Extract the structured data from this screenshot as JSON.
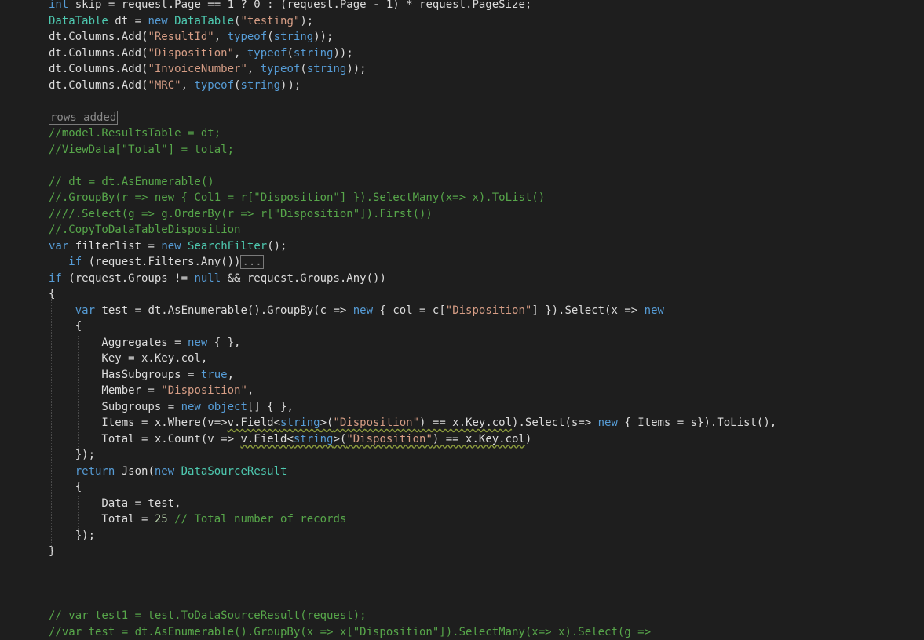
{
  "editor": {
    "lines": [
      {
        "tokens": [
          {
            "t": "kw",
            "v": "int"
          },
          {
            "t": "pl",
            "v": " skip = request.Page == 1 ? 0 : (request.Page - 1) * request.PageSize;"
          }
        ]
      },
      {
        "tokens": [
          {
            "t": "ty",
            "v": "DataTable"
          },
          {
            "t": "pl",
            "v": " dt = "
          },
          {
            "t": "kw",
            "v": "new"
          },
          {
            "t": "pl",
            "v": " "
          },
          {
            "t": "ty",
            "v": "DataTable"
          },
          {
            "t": "pl",
            "v": "("
          },
          {
            "t": "str",
            "v": "\"testing\""
          },
          {
            "t": "pl",
            "v": ");"
          }
        ]
      },
      {
        "tokens": [
          {
            "t": "pl",
            "v": "dt.Columns.Add("
          },
          {
            "t": "str",
            "v": "\"ResultId\""
          },
          {
            "t": "pl",
            "v": ", "
          },
          {
            "t": "kw",
            "v": "typeof"
          },
          {
            "t": "pl",
            "v": "("
          },
          {
            "t": "kw",
            "v": "string"
          },
          {
            "t": "pl",
            "v": "));"
          }
        ]
      },
      {
        "tokens": [
          {
            "t": "pl",
            "v": "dt.Columns.Add("
          },
          {
            "t": "str",
            "v": "\"Disposition\""
          },
          {
            "t": "pl",
            "v": ", "
          },
          {
            "t": "kw",
            "v": "typeof"
          },
          {
            "t": "pl",
            "v": "("
          },
          {
            "t": "kw",
            "v": "string"
          },
          {
            "t": "pl",
            "v": "));"
          }
        ]
      },
      {
        "tokens": [
          {
            "t": "pl",
            "v": "dt.Columns.Add("
          },
          {
            "t": "str",
            "v": "\"InvoiceNumber\""
          },
          {
            "t": "pl",
            "v": ", "
          },
          {
            "t": "kw",
            "v": "typeof"
          },
          {
            "t": "pl",
            "v": "("
          },
          {
            "t": "kw",
            "v": "string"
          },
          {
            "t": "pl",
            "v": "));"
          }
        ]
      },
      {
        "tokens": [
          {
            "t": "pl",
            "v": "dt.Columns.Add("
          },
          {
            "t": "str",
            "v": "\"MRC\""
          },
          {
            "t": "pl",
            "v": ", "
          },
          {
            "t": "kw",
            "v": "typeof"
          },
          {
            "t": "pl",
            "v": "("
          },
          {
            "t": "kw",
            "v": "string"
          },
          {
            "t": "pl",
            "v": ")"
          },
          {
            "t": "caret",
            "v": ""
          },
          {
            "t": "pl",
            "v": ");"
          }
        ]
      },
      {
        "tokens": []
      },
      {
        "tokens": [
          {
            "t": "box",
            "v": "rows added"
          }
        ]
      },
      {
        "tokens": [
          {
            "t": "cm",
            "v": "//model.ResultsTable = dt;"
          }
        ]
      },
      {
        "tokens": [
          {
            "t": "cm",
            "v": "//ViewData[\"Total\"] = total;"
          }
        ]
      },
      {
        "tokens": []
      },
      {
        "tokens": [
          {
            "t": "cm",
            "v": "// dt = dt.AsEnumerable()"
          }
        ]
      },
      {
        "tokens": [
          {
            "t": "cm",
            "v": "//.GroupBy(r => new { Col1 = r[\"Disposition\"] }).SelectMany(x=> x).ToList()"
          }
        ]
      },
      {
        "tokens": [
          {
            "t": "cm",
            "v": "////.Select(g => g.OrderBy(r => r[\"Disposition\"]).First())"
          }
        ]
      },
      {
        "tokens": [
          {
            "t": "cm",
            "v": "//.CopyToDataTableDisposition"
          }
        ]
      },
      {
        "tokens": [
          {
            "t": "kw",
            "v": "var"
          },
          {
            "t": "pl",
            "v": " filterlist = "
          },
          {
            "t": "kw",
            "v": "new"
          },
          {
            "t": "pl",
            "v": " "
          },
          {
            "t": "ty",
            "v": "SearchFilter"
          },
          {
            "t": "pl",
            "v": "();"
          }
        ]
      },
      {
        "tokens": [
          {
            "t": "pl",
            "v": "   "
          },
          {
            "t": "kw",
            "v": "if"
          },
          {
            "t": "pl",
            "v": " (request.Filters.Any())"
          },
          {
            "t": "box",
            "v": "..."
          }
        ]
      },
      {
        "tokens": [
          {
            "t": "kw",
            "v": "if"
          },
          {
            "t": "pl",
            "v": " (request.Groups != "
          },
          {
            "t": "kw",
            "v": "null"
          },
          {
            "t": "pl",
            "v": " && request.Groups.Any())"
          }
        ]
      },
      {
        "tokens": [
          {
            "t": "pl",
            "v": "{"
          }
        ]
      },
      {
        "tokens": [
          {
            "t": "pl",
            "v": "    "
          },
          {
            "t": "kw",
            "v": "var"
          },
          {
            "t": "pl",
            "v": " test = dt.AsEnumerable().GroupBy(c => "
          },
          {
            "t": "kw",
            "v": "new"
          },
          {
            "t": "pl",
            "v": " { col = c["
          },
          {
            "t": "str",
            "v": "\"Disposition\""
          },
          {
            "t": "pl",
            "v": "] }).Select(x => "
          },
          {
            "t": "kw",
            "v": "new"
          }
        ]
      },
      {
        "tokens": [
          {
            "t": "pl",
            "v": "    {"
          }
        ]
      },
      {
        "tokens": [
          {
            "t": "pl",
            "v": "        Aggregates = "
          },
          {
            "t": "kw",
            "v": "new"
          },
          {
            "t": "pl",
            "v": " { },"
          }
        ]
      },
      {
        "tokens": [
          {
            "t": "pl",
            "v": "        Key = x.Key.col,"
          }
        ]
      },
      {
        "tokens": [
          {
            "t": "pl",
            "v": "        HasSubgroups = "
          },
          {
            "t": "kw",
            "v": "true"
          },
          {
            "t": "pl",
            "v": ","
          }
        ]
      },
      {
        "tokens": [
          {
            "t": "pl",
            "v": "        Member = "
          },
          {
            "t": "str",
            "v": "\"Disposition\""
          },
          {
            "t": "pl",
            "v": ","
          }
        ]
      },
      {
        "tokens": [
          {
            "t": "pl",
            "v": "        Subgroups = "
          },
          {
            "t": "kw",
            "v": "new"
          },
          {
            "t": "pl",
            "v": " "
          },
          {
            "t": "kw",
            "v": "object"
          },
          {
            "t": "pl",
            "v": "[] { },"
          }
        ]
      },
      {
        "tokens": [
          {
            "t": "pl",
            "v": "        Items = x.Where(v=>"
          },
          {
            "t": "sq",
            "v": "v.Field<"
          },
          {
            "t": "sqk",
            "v": "string"
          },
          {
            "t": "sq",
            "v": ">("
          },
          {
            "t": "sqs",
            "v": "\"Disposition\""
          },
          {
            "t": "sq",
            "v": ") == x.Key.col"
          },
          {
            "t": "pl",
            "v": ").Select(s=> "
          },
          {
            "t": "kw",
            "v": "new"
          },
          {
            "t": "pl",
            "v": " { Items = s}).ToList(),"
          }
        ]
      },
      {
        "tokens": [
          {
            "t": "pl",
            "v": "        Total = x.Count(v => "
          },
          {
            "t": "sq",
            "v": "v.Field<"
          },
          {
            "t": "sqk",
            "v": "string"
          },
          {
            "t": "sq",
            "v": ">("
          },
          {
            "t": "sqs",
            "v": "\"Disposition\""
          },
          {
            "t": "sq",
            "v": ") == x.Key.col"
          },
          {
            "t": "pl",
            "v": ")"
          }
        ]
      },
      {
        "tokens": [
          {
            "t": "pl",
            "v": "    });"
          }
        ]
      },
      {
        "tokens": [
          {
            "t": "pl",
            "v": "    "
          },
          {
            "t": "kw",
            "v": "return"
          },
          {
            "t": "pl",
            "v": " Json("
          },
          {
            "t": "kw",
            "v": "new"
          },
          {
            "t": "pl",
            "v": " "
          },
          {
            "t": "ty",
            "v": "DataSourceResult"
          }
        ]
      },
      {
        "tokens": [
          {
            "t": "pl",
            "v": "    {"
          }
        ]
      },
      {
        "tokens": [
          {
            "t": "pl",
            "v": "        Data = test,"
          }
        ]
      },
      {
        "tokens": [
          {
            "t": "pl",
            "v": "        Total = "
          },
          {
            "t": "num",
            "v": "25"
          },
          {
            "t": "pl",
            "v": " "
          },
          {
            "t": "cm",
            "v": "// Total number of records"
          }
        ]
      },
      {
        "tokens": [
          {
            "t": "pl",
            "v": "    });"
          }
        ]
      },
      {
        "tokens": [
          {
            "t": "pl",
            "v": "}"
          }
        ]
      },
      {
        "tokens": []
      },
      {
        "tokens": []
      },
      {
        "tokens": []
      },
      {
        "tokens": [
          {
            "t": "cm",
            "v": "// var test1 = test.ToDataSourceResult(request);"
          }
        ]
      },
      {
        "tokens": [
          {
            "t": "cm",
            "v": "//var test = dt.AsEnumerable().GroupBy(x => x[\"Disposition\"]).SelectMany(x=> x).Select(g =>"
          }
        ]
      }
    ]
  }
}
